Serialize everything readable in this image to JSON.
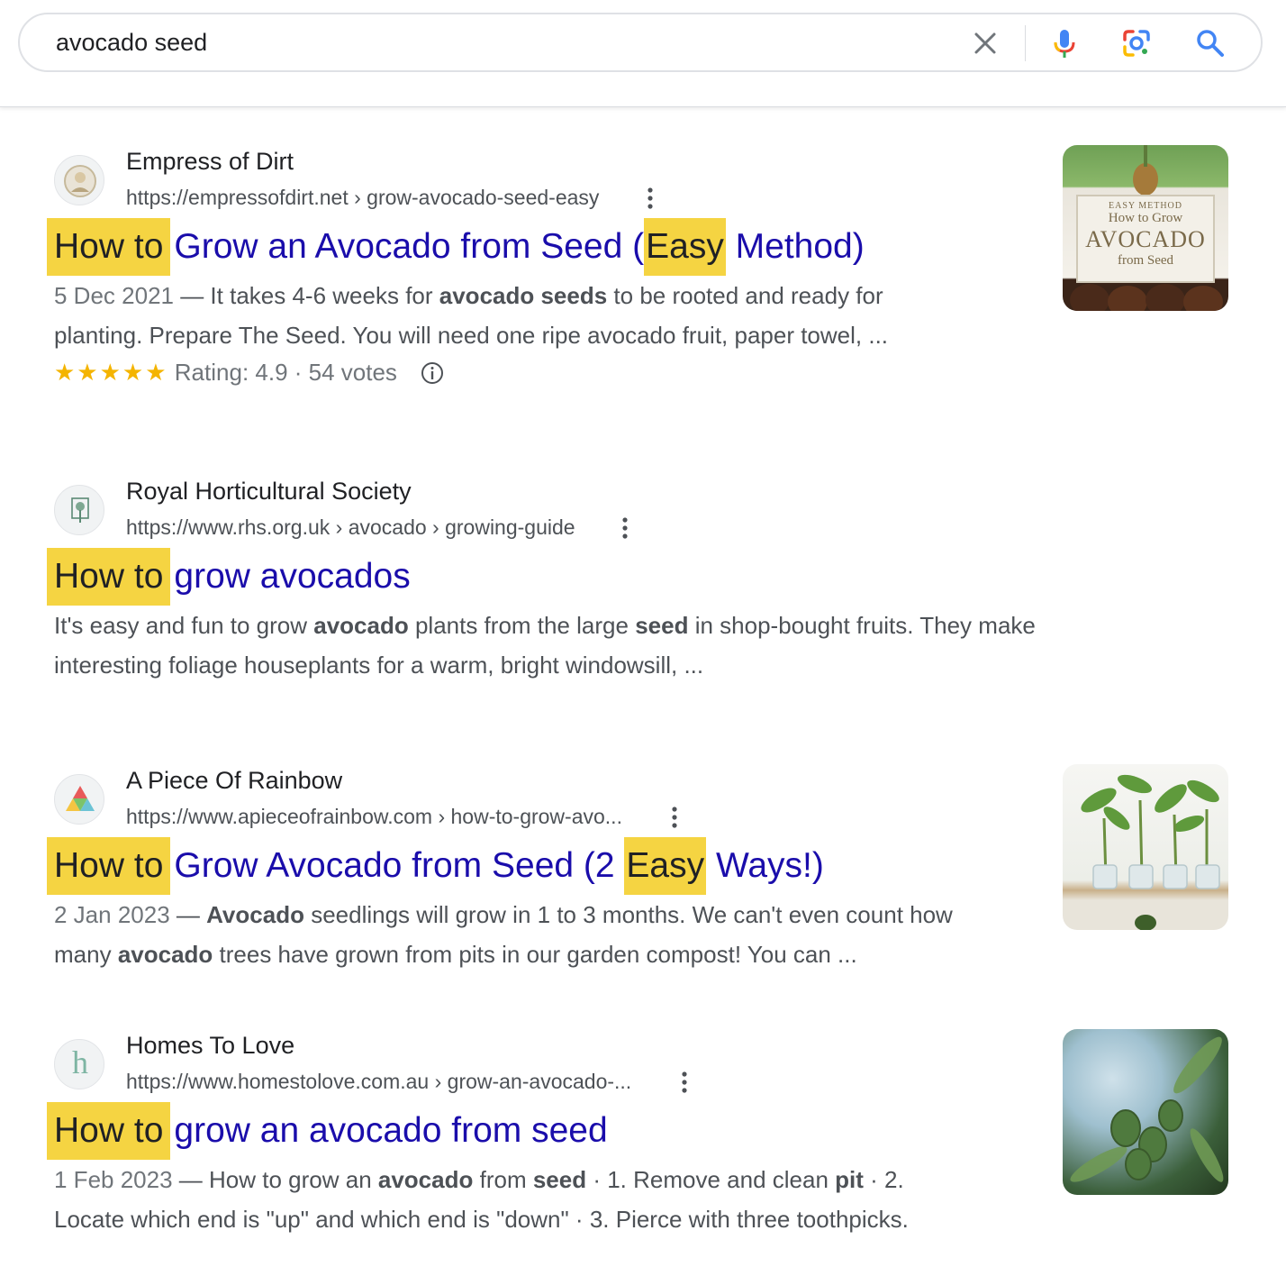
{
  "search": {
    "query": "avocado seed",
    "clear_icon": "close-icon",
    "voice_icon": "microphone-icon",
    "lens_icon": "camera-lens-icon",
    "search_icon": "search-icon"
  },
  "colors": {
    "link": "#1a0dab",
    "highlight": "#f5d442",
    "snippet": "#4d5156",
    "star": "#f4b400"
  },
  "results": [
    {
      "site_name": "Empress of Dirt",
      "url": "https://empressofdirt.net › grow-avocado-seed-easy",
      "title_hl": "How to",
      "title_part1": "Grow an Avocado from Seed (",
      "title_hl2": "Easy",
      "title_part2": " Method)",
      "date": "5 Dec 2021",
      "snippet_l1a": " — It takes 4-6 weeks for ",
      "snippet_l1b": "avocado seeds",
      "snippet_l1c": " to be rooted and ready for",
      "snippet_l2": "planting. Prepare The Seed. You will need one ripe avocado fruit, paper towel, ...",
      "stars": "★★★★★",
      "rating_text": "Rating: 4.9 · 54 votes",
      "thumb_text_top": "EASY METHOD",
      "thumb_text_1": "How to Grow",
      "thumb_text_2": "AVOCADO",
      "thumb_text_3": "from Seed"
    },
    {
      "site_name": "Royal Horticultural Society",
      "url": "https://www.rhs.org.uk › avocado › growing-guide",
      "title_hl": "How to",
      "title_rest": "grow avocados",
      "s1a": "It's easy and fun to grow ",
      "s1b": "avocado",
      "s1c": " plants from the large ",
      "s1d": "seed",
      "s1e": " in shop-bought fruits. They make",
      "s2": "interesting foliage houseplants for a warm, bright windowsill, ..."
    },
    {
      "site_name": "A Piece Of Rainbow",
      "url": "https://www.apieceofrainbow.com › how-to-grow-avo...",
      "title_hl": "How to",
      "title_part1": "Grow Avocado from Seed (2 ",
      "title_hl2": "Easy",
      "title_part2": " Ways!)",
      "date": "2 Jan 2023",
      "s1a": " — ",
      "s1b": "Avocado",
      "s1c": " seedlings will grow in 1 to 3 months. We can't even count how",
      "s2a": "many ",
      "s2b": "avocado",
      "s2c": " trees have grown from pits in our garden compost! You can ..."
    },
    {
      "site_name": "Homes To Love",
      "url": "https://www.homestolove.com.au › grow-an-avocado-...",
      "favicon_letter": "h",
      "title_hl": "How to",
      "title_rest": "grow an avocado from seed",
      "date": "1 Feb 2023",
      "s1a": " — How to grow an ",
      "s1b": "avocado",
      "s1c": " from ",
      "s1d": "seed",
      "s1e": " · 1. Remove and clean ",
      "s1f": "pit",
      "s1g": " · 2.",
      "s2": "Locate which end is \"up\" and which end is \"down\" · 3. Pierce with three toothpicks."
    }
  ]
}
